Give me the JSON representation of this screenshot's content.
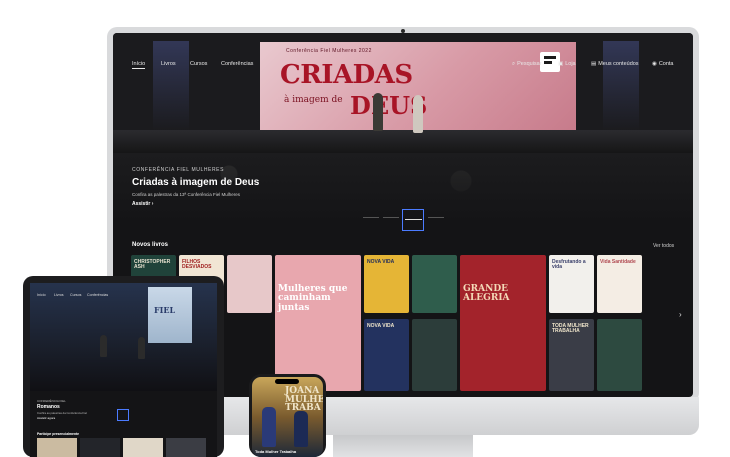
{
  "desktop": {
    "nav": {
      "items": [
        "Início",
        "Livros",
        "Cursos",
        "Conferências"
      ],
      "right": [
        "Pesquisar",
        "Loja",
        "Meus conteúdos",
        "Conta"
      ]
    },
    "banner": {
      "top": "Conferência Fiel Mulheres 2022",
      "title": "CRIADAS",
      "sub": "à imagem de",
      "deus": "DEUS"
    },
    "hero": {
      "kicker": "CONFERÊNCIA FIEL MULHERES",
      "title": "Criadas à imagem de Deus",
      "description": "Confira as palestras da 13ª Conferência Fiel Mulheres",
      "cta": "Assistir"
    },
    "section": {
      "title": "Novos livros",
      "link": "Ver todos"
    },
    "books": [
      {
        "label": "CHRISTOPHER ASH",
        "color": "#20433a",
        "text": "#e8e2d0"
      },
      {
        "label": "FILHOS DESVIADOS",
        "color": "#f1e5d4",
        "text": "#a02020"
      },
      {
        "label": "",
        "color": "#e7c8c9",
        "text": "#6a2030"
      },
      {
        "label": "Mulheres que caminham juntas",
        "color": "#e8a7ae",
        "text": "#ffffff"
      },
      {
        "label": "NOVA VIDA",
        "color": "#e5b536",
        "text": "#1d2a5a"
      },
      {
        "label": "",
        "color": "#2f5d4c",
        "text": "#ffffff"
      },
      {
        "label": "GRANDE ALEGRIA",
        "color": "#a3232b",
        "text": "#f4d9b8"
      },
      {
        "label": "Desfrutando a vida",
        "color": "#f2f0ec",
        "text": "#3a3f6a"
      },
      {
        "label": "Vida Santidade",
        "color": "#f4ede4",
        "text": "#b04850"
      }
    ],
    "books_row2": [
      {
        "label": "",
        "color": "#d9d2c9"
      },
      {
        "label": "",
        "color": "#f3e4dc"
      },
      {
        "label": "NOVA VIDA",
        "color": "#23325f"
      },
      {
        "label": "",
        "color": "#2c3d3a"
      },
      {
        "label": "TODA MULHER TRABALHA",
        "color": "#3a3d47"
      },
      {
        "label": "",
        "color": "#2d4a40"
      }
    ]
  },
  "tablet": {
    "nav": [
      "Início",
      "Livros",
      "Cursos",
      "Conferências"
    ],
    "banner": "FIEL",
    "hero": {
      "kicker": "CONFERÊNCIA FIEL",
      "title": "Romanos",
      "description": "Confira as palestras da Conferência Fiel",
      "cta": "Assistir agora"
    },
    "section": "Participe presencialmente"
  },
  "phone": {
    "word": "JOANA\nMULHE\nTRABA",
    "caption": "Toda Mulher Trabalha"
  },
  "colors": {
    "accent_selection": "#4b7bff",
    "device_frame": "#d9dadc",
    "screen_bg": "#141416"
  }
}
